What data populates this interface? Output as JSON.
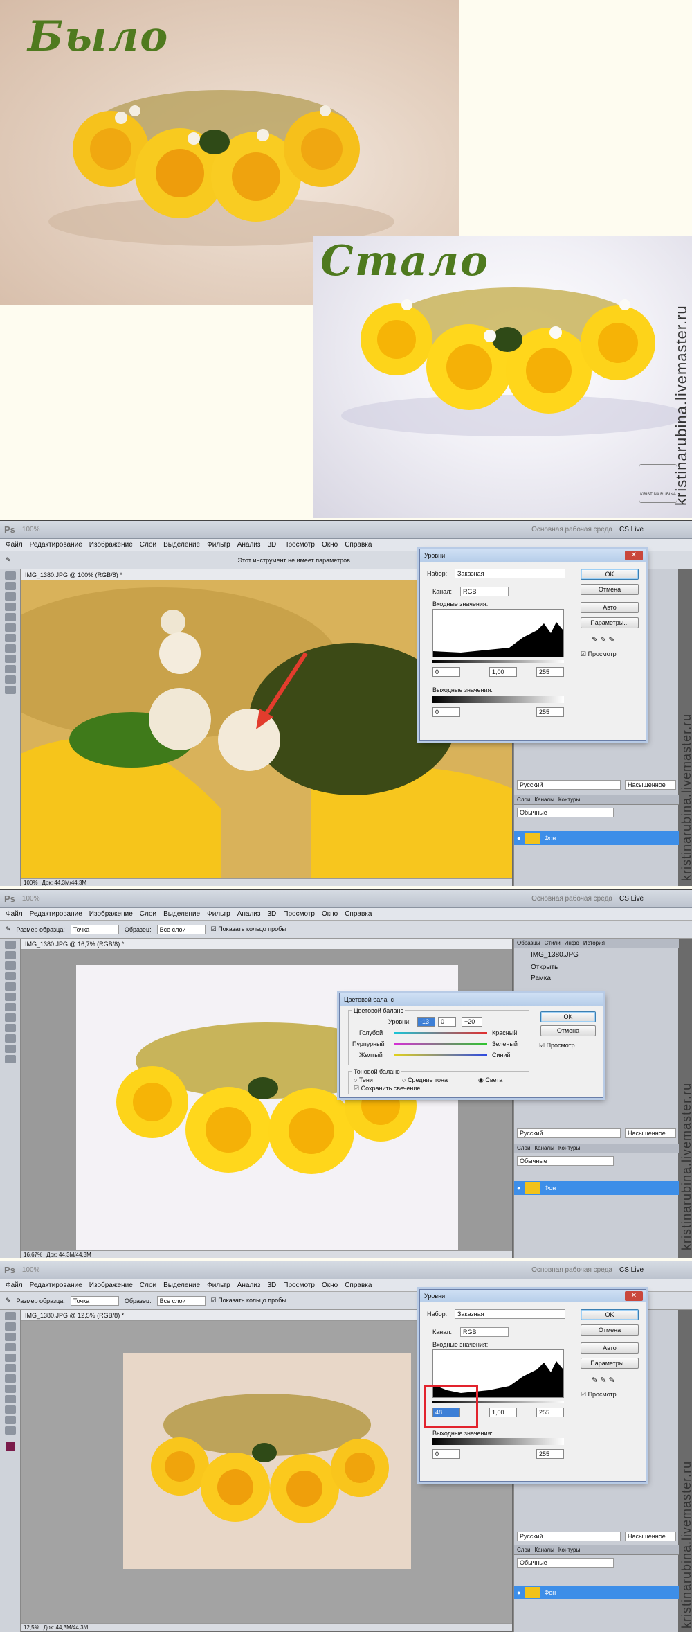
{
  "before_title": "Было",
  "after_title": "Стало",
  "watermark": "kristinarubina.livemaster.ru",
  "logo_text": "KRISTINA RUBINA",
  "colors": {
    "title_green": "#4f7a1f",
    "accent_red": "#e23c2d",
    "layer_blue": "#3d8ee8"
  },
  "shots": [
    {
      "top": {
        "logo": "Ps",
        "zoom": "100%",
        "workspace": "Основная рабочая среда",
        "cslive": "CS Live"
      },
      "menu": [
        "Файл",
        "Редактирование",
        "Изображение",
        "Слои",
        "Выделение",
        "Фильтр",
        "Анализ",
        "3D",
        "Просмотр",
        "Окно",
        "Справка"
      ],
      "options": {
        "hint": "Этот инструмент не имеет параметров."
      },
      "doc_tab": "IMG_1380.JPG @ 100% (RGB/8) *",
      "status": {
        "zoom": "100%",
        "doc": "Док: 44,3M/44,3M"
      },
      "layer_name": "Фон",
      "panel_tabs": [
        "Слои",
        "Каналы",
        "Контуры"
      ],
      "blend_mode": "Обычные",
      "lang_select": "Русский",
      "aa_select": "Насыщенное"
    },
    {
      "top": {
        "logo": "Ps",
        "zoom": "100%",
        "workspace": "Основная рабочая среда",
        "cslive": "CS Live"
      },
      "menu": [
        "Файл",
        "Редактирование",
        "Изображение",
        "Слои",
        "Выделение",
        "Фильтр",
        "Анализ",
        "3D",
        "Просмотр",
        "Окно",
        "Справка"
      ],
      "options": {
        "sample_size_label": "Размер образца:",
        "sample_size": "Точка",
        "samples_label": "Образец:",
        "samples": "Все слои",
        "show_ring": "Показать кольцо пробы"
      },
      "doc_tab": "IMG_1380.JPG @ 16,7% (RGB/8) *",
      "status": {
        "zoom": "16,67%",
        "doc": "Док: 44,3M/44,3M"
      },
      "layer_name": "Фон",
      "panel_tabs": [
        "Слои",
        "Каналы",
        "Контуры"
      ],
      "history_tabs": [
        "Образцы",
        "Стили",
        "Инфо",
        "История"
      ],
      "history_items": [
        "IMG_1380.JPG",
        "Открыть",
        "Рамка"
      ],
      "blend_mode": "Обычные",
      "lang_select": "Русский",
      "aa_select": "Насыщенное"
    },
    {
      "top": {
        "logo": "Ps",
        "zoom": "100%",
        "workspace": "Основная рабочая среда",
        "cslive": "CS Live"
      },
      "menu": [
        "Файл",
        "Редактирование",
        "Изображение",
        "Слои",
        "Выделение",
        "Фильтр",
        "Анализ",
        "3D",
        "Просмотр",
        "Окно",
        "Справка"
      ],
      "options": {
        "sample_size_label": "Размер образца:",
        "sample_size": "Точка",
        "samples_label": "Образец:",
        "samples": "Все слои",
        "show_ring": "Показать кольцо пробы"
      },
      "doc_tab": "IMG_1380.JPG @ 12,5% (RGB/8) *",
      "status": {
        "zoom": "12,5%",
        "doc": "Док: 44,3M/44,3M"
      },
      "layer_name": "Фон",
      "panel_tabs": [
        "Слои",
        "Каналы",
        "Контуры"
      ],
      "blend_mode": "Обычные",
      "lang_select": "Русский",
      "aa_select": "Насыщенное"
    }
  ],
  "levels1": {
    "title": "Уровни",
    "preset_label": "Набор:",
    "preset": "Заказная",
    "channel_label": "Канал:",
    "channel": "RGB",
    "input_label": "Входные значения:",
    "output_label": "Выходные значения:",
    "in_black": "0",
    "in_gamma": "1,00",
    "in_white": "255",
    "out_black": "0",
    "out_white": "255",
    "ok": "OK",
    "cancel": "Отмена",
    "auto": "Авто",
    "options": "Параметры...",
    "preview": "Просмотр"
  },
  "color_balance": {
    "title": "Цветовой баланс",
    "group": "Цветовой баланс",
    "levels_label": "Уровни:",
    "l1": "-13",
    "l2": "0",
    "l3": "+20",
    "rows": [
      {
        "left": "Голубой",
        "right": "Красный"
      },
      {
        "left": "Пурпурный",
        "right": "Зеленый"
      },
      {
        "left": "Желтый",
        "right": "Синий"
      }
    ],
    "tone_group": "Тоновой баланс",
    "shadows": "Тени",
    "midtones": "Средние тона",
    "highlights": "Света",
    "preserve": "Сохранить свечение",
    "ok": "OK",
    "cancel": "Отмена",
    "preview": "Просмотр"
  },
  "levels2": {
    "title": "Уровни",
    "preset_label": "Набор:",
    "preset": "Заказная",
    "channel_label": "Канал:",
    "channel": "RGB",
    "input_label": "Входные значения:",
    "output_label": "Выходные значения:",
    "in_black": "48",
    "in_gamma": "1,00",
    "in_white": "255",
    "out_black": "0",
    "out_white": "255",
    "ok": "OK",
    "cancel": "Отмена",
    "auto": "Авто",
    "options": "Параметры...",
    "preview": "Просмотр"
  }
}
